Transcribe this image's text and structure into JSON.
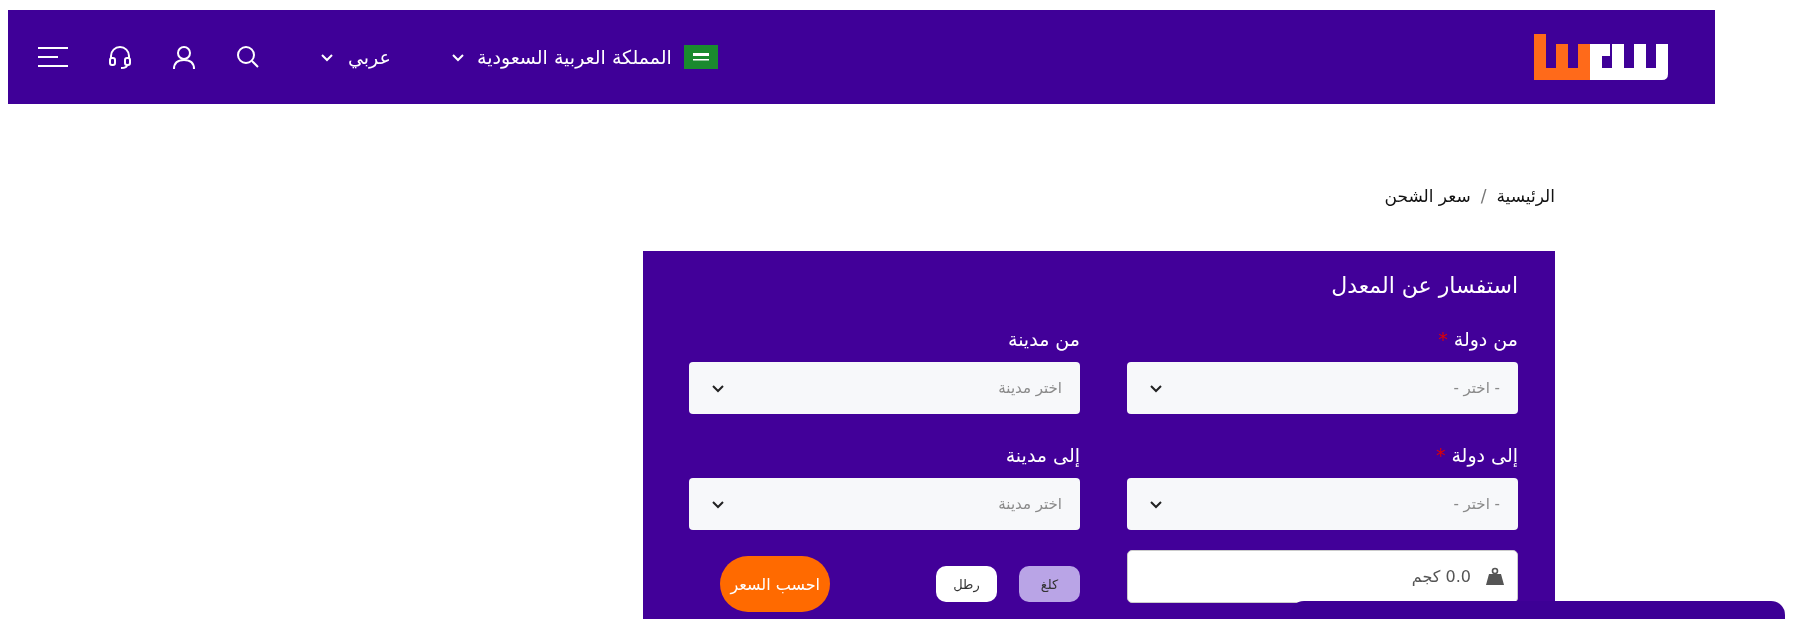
{
  "header": {
    "country": "المملكة العربية السعودية",
    "language": "عربي"
  },
  "breadcrumb": {
    "items": [
      "الرئيسية",
      "سعر الشحن"
    ],
    "separator": "/"
  },
  "form": {
    "title": "استفسار عن المعدل",
    "fields": [
      {
        "label": "من دولة",
        "required": true,
        "placeholder": "- اختر -"
      },
      {
        "label": "من مدينة",
        "required": false,
        "placeholder": "اختر مدينة"
      },
      {
        "label": "إلى دولة",
        "required": true,
        "placeholder": "- اختر -"
      },
      {
        "label": "إلى مدينة",
        "required": false,
        "placeholder": "اختر مدينة"
      }
    ],
    "required_mark": "*",
    "weight": {
      "placeholder": "0.0 كجم"
    },
    "units": [
      {
        "label": "كلغ",
        "selected": true
      },
      {
        "label": "رطل",
        "selected": false
      }
    ],
    "submit": "احسب السعر"
  }
}
